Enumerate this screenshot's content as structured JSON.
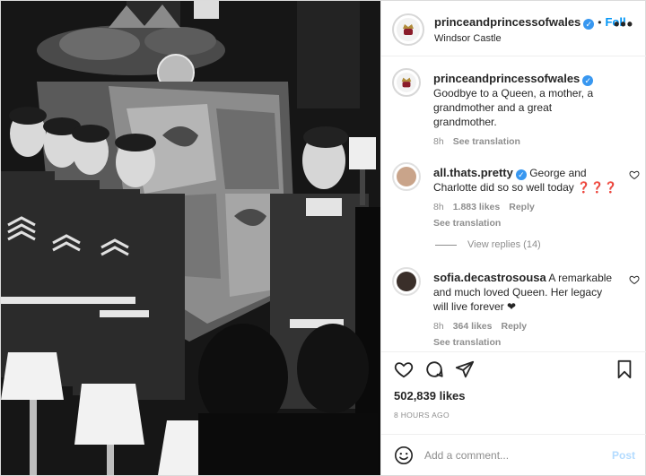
{
  "account": {
    "username": "princeandprincessofwales",
    "location": "Windsor Castle",
    "follow_label": "Foll",
    "dot": "•",
    "more": "•••"
  },
  "caption": {
    "username": "princeandprincessofwales",
    "text": "Goodbye to a Queen, a mother, a grandmother and a great grandmother.",
    "time": "8h",
    "see_translation": "See translation"
  },
  "comments": [
    {
      "username": "all.thats.pretty",
      "text": "George and Charlotte did so so well today ❓❓❓",
      "time": "8h",
      "likes": "1.883 likes",
      "reply": "Reply",
      "see_translation": "See translation",
      "view_replies": "View replies (14)"
    },
    {
      "username": "sofia.decastrosousa",
      "text": "A remarkable and much loved Queen. Her legacy will live forever ❤",
      "time": "8h",
      "likes": "364 likes",
      "reply": "Reply",
      "see_translation": "See translation"
    }
  ],
  "stats": {
    "likes": "502,839 likes",
    "time_ago": "8 HOURS AGO"
  },
  "add_comment": {
    "placeholder": "Add a comment...",
    "post_label": "Post"
  },
  "icons": {
    "verified": "verified-badge-icon",
    "like": "heart-icon",
    "comment": "comment-bubble-icon",
    "share": "paper-plane-icon",
    "save": "bookmark-icon",
    "emoji": "smiley-icon",
    "more": "ellipsis-icon"
  },
  "colors": {
    "link_blue": "#0095f6",
    "verified_blue": "#3897f0",
    "muted_text": "#8e8e8e",
    "post_disabled": "#b3dbff"
  }
}
